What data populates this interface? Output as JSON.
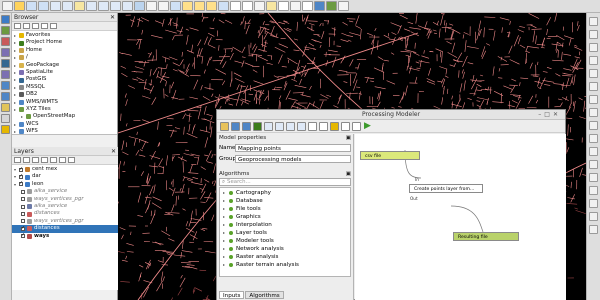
{
  "browser_panel": {
    "title": "Browser",
    "items": [
      {
        "label": "Favorites",
        "icon": "star-icon",
        "color": "#e5b700",
        "indent": 0
      },
      {
        "label": "Project Home",
        "icon": "folder-icon",
        "color": "#3c7d1c",
        "indent": 0
      },
      {
        "label": "Home",
        "icon": "folder-icon",
        "color": "#c9a44a",
        "indent": 0
      },
      {
        "label": "/",
        "icon": "folder-icon",
        "color": "#c9a44a",
        "indent": 0
      },
      {
        "label": "GeoPackage",
        "icon": "geopackage-icon",
        "color": "#d8b34c",
        "indent": 0
      },
      {
        "label": "SpatiaLite",
        "icon": "feather-icon",
        "color": "#7b6fb2",
        "indent": 0
      },
      {
        "label": "PostGIS",
        "icon": "elephant-icon",
        "color": "#336791",
        "indent": 0
      },
      {
        "label": "MSSQL",
        "icon": "database-icon",
        "color": "#8a8a8a",
        "indent": 0
      },
      {
        "label": "DB2",
        "icon": "database-icon",
        "color": "#5b5b5b",
        "indent": 0
      },
      {
        "label": "WMS/WMTS",
        "icon": "globe-icon",
        "color": "#4f86c6",
        "indent": 0
      },
      {
        "label": "XYZ Tiles",
        "icon": "tiles-icon",
        "color": "#6c9b41",
        "indent": 0
      },
      {
        "label": "OpenStreetMap",
        "icon": "tiles-icon",
        "color": "#6c9b41",
        "indent": 1
      },
      {
        "label": "WCS",
        "icon": "globe-icon",
        "color": "#4f86c6",
        "indent": 0
      },
      {
        "label": "WFS",
        "icon": "globe-icon",
        "color": "#4f86c6",
        "indent": 0
      }
    ]
  },
  "layers_panel": {
    "title": "Layers",
    "items": [
      {
        "label": "cent mex",
        "checked": true,
        "indent": 0,
        "style": "normal",
        "color": "#c07a2c",
        "selected": false
      },
      {
        "label": "dar",
        "checked": true,
        "indent": 0,
        "style": "normal",
        "color": "#3c7bc6",
        "selected": false
      },
      {
        "label": "leon",
        "checked": true,
        "indent": 0,
        "style": "normal",
        "color": "#3c7bc6",
        "selected": false
      },
      {
        "label": "aika_service",
        "checked": false,
        "indent": 1,
        "style": "italic",
        "color": "#9d9d9d",
        "selected": false
      },
      {
        "label": "ways_vertices_pgr",
        "checked": false,
        "indent": 1,
        "style": "italic",
        "color": "#9d9d9d",
        "selected": false
      },
      {
        "label": "aika_service",
        "checked": false,
        "indent": 1,
        "style": "italic",
        "color": "#6c7aa8",
        "selected": false
      },
      {
        "label": "distances",
        "checked": false,
        "indent": 1,
        "style": "italic",
        "color": "#c95a5a",
        "selected": false
      },
      {
        "label": "ways_vertices_pgr",
        "checked": false,
        "indent": 1,
        "style": "italic",
        "color": "#9d9d9d",
        "selected": false
      },
      {
        "label": "distances",
        "checked": true,
        "indent": 1,
        "style": "normal",
        "color": "#c95a5a",
        "selected": true
      },
      {
        "label": "ways",
        "checked": true,
        "indent": 1,
        "style": "bold",
        "color": "#b34a4a",
        "selected": false
      }
    ]
  },
  "modeler": {
    "title": "Processing Modeler",
    "model_properties_title": "Model properties",
    "name_label": "Name",
    "name_value": "Mapping points",
    "group_label": "Group",
    "group_value": "Geoprocessing models",
    "algorithms_title": "Algorithms",
    "search_placeholder": "Search...",
    "algorithms": [
      "Cartography",
      "Database",
      "File tools",
      "Graphics",
      "Interpolation",
      "Layer tools",
      "Modeler tools",
      "Network analysis",
      "Raster analysis",
      "Raster terrain analysis"
    ],
    "tabs": [
      "Inputs",
      "Algorithms"
    ],
    "nodes": {
      "input": {
        "label": "csv file",
        "color": "#dce97b"
      },
      "algorithm": {
        "label": "Create points layer from...",
        "color": "#ffffff"
      },
      "output": {
        "label": "Resulting file",
        "color": "#b9d26a"
      },
      "in_port": "In",
      "out_port": "Out"
    }
  },
  "colors": {
    "road": "#f08a8a",
    "road_dim": "#a4494b",
    "map_bg": "#000000",
    "selection": "#3074b8"
  }
}
